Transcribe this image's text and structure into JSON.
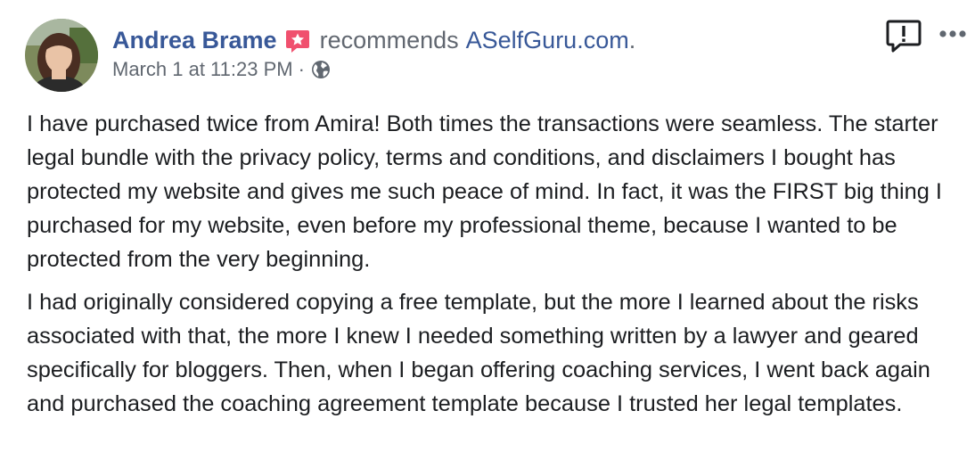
{
  "post": {
    "author": "Andrea Brame",
    "action": "recommends",
    "page_link": "ASelfGuru.com",
    "action_suffix": ".",
    "timestamp": "March 1 at 11:23 PM",
    "separator": "·",
    "privacy_icon": "globe-icon",
    "badge_icon": "star-badge-icon",
    "report_icon": "report-icon",
    "more_icon": "more-options-icon",
    "paragraphs": [
      "I have purchased twice from Amira! Both times the transactions were seamless. The starter legal bundle with the privacy policy, terms and conditions, and disclaimers I bought has protected my website and gives me such peace of mind. In fact, it was the FIRST big thing I purchased for my website, even before my professional theme, because I wanted to be protected from the very beginning.",
      "I had originally considered copying a free template, but the more I learned about the risks associated with that, the more I knew I needed something written by a lawyer and geared specifically for bloggers. Then, when I began offering coaching services, I went back again and purchased the coaching agreement template because I trusted her legal templates."
    ]
  },
  "colors": {
    "link": "#385898",
    "secondary_text": "#606770",
    "body_text": "#1c1e21",
    "badge": "#f0506e"
  }
}
